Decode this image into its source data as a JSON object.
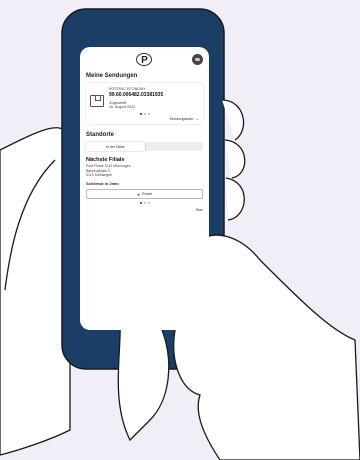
{
  "app": {
    "logo_text": "P",
    "sections": {
      "shipments_title": "Meine Sendungen",
      "locations_title": "Standorte"
    },
    "shipment": {
      "product": "POSTPAC ECONOMY",
      "tracking_number": "99.60.006482.03381935",
      "status": "Zugestellt",
      "date": "16. August 2023",
      "list_link": "Sendungsliste"
    },
    "locations": {
      "tabs": [
        "In der Nähe",
        ""
      ],
      "active_tab": 0,
      "branch_title": "Nächste Filiale",
      "address_lines": [
        "Post Filiale 3110 Münsingen",
        "Bahnhofplatz 3",
        "3110 Münsingen"
      ],
      "closing_text": "Schliesst in 2min",
      "route_label": "Route",
      "more_link": "Stan"
    }
  },
  "colors": {
    "background": "#f1eef8",
    "phone_frame": "#1b3e66",
    "phone_outline": "#1a1a1a",
    "skin": "#ffffff"
  }
}
